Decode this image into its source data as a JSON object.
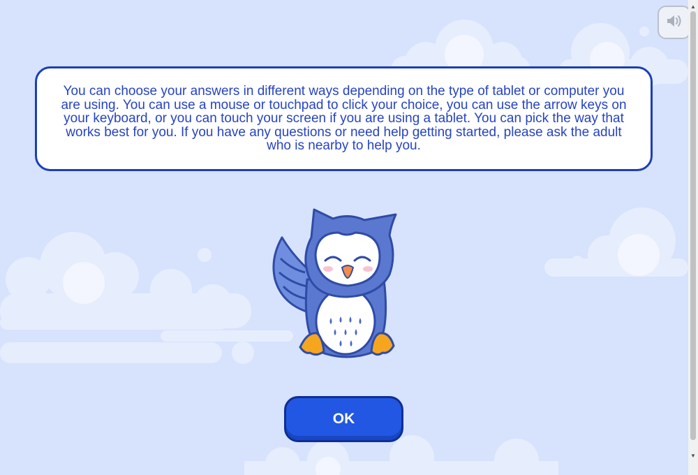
{
  "instructions": {
    "text": "You can choose your answers in different ways depending on the type of tablet or computer you are using. You can use a mouse or touchpad to click your choice, you can use the arrow keys on your keyboard, or you can touch your screen if you are using a tablet. You can pick the way that works best for you. If you have any questions or need help getting started, please ask the adult who is nearby to help you."
  },
  "ok_button": {
    "label": "OK"
  },
  "icons": {
    "sound": "speaker-icon",
    "mascot": "owl-mascot",
    "scroll_up": "scroll-up-arrow-icon",
    "scroll_down": "scroll-down-arrow-icon"
  },
  "colors": {
    "background": "#d7e2fc",
    "text": "#2643c4",
    "box_border": "#1c3fb6",
    "button": "#2157e2"
  }
}
